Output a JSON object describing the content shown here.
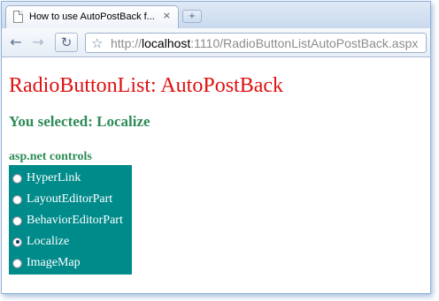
{
  "browser": {
    "tab_title": "How to use AutoPostBack f...",
    "tab_close": "×",
    "new_tab": "+",
    "url_scheme": "http://",
    "url_host": "localhost",
    "url_path": ":1110/RadioButtonListAutoPostBack.aspx"
  },
  "page": {
    "title": "RadioButtonList: AutoPostBack",
    "selected_text": "You selected: Localize",
    "group_label": "asp.net controls",
    "radio_list": {
      "background": "#008b8b",
      "items": [
        {
          "label": "HyperLink",
          "checked": false
        },
        {
          "label": "LayoutEditorPart",
          "checked": false
        },
        {
          "label": "BehaviorEditorPart",
          "checked": false
        },
        {
          "label": "Localize",
          "checked": true
        },
        {
          "label": "ImageMap",
          "checked": false
        }
      ]
    }
  },
  "colors": {
    "title": "#e01010",
    "accent_green": "#2e8b57"
  },
  "icons": {
    "back": "back-arrow-icon",
    "forward": "forward-arrow-icon",
    "reload": "reload-icon",
    "bookmark": "star-icon",
    "favicon": "page-icon"
  }
}
